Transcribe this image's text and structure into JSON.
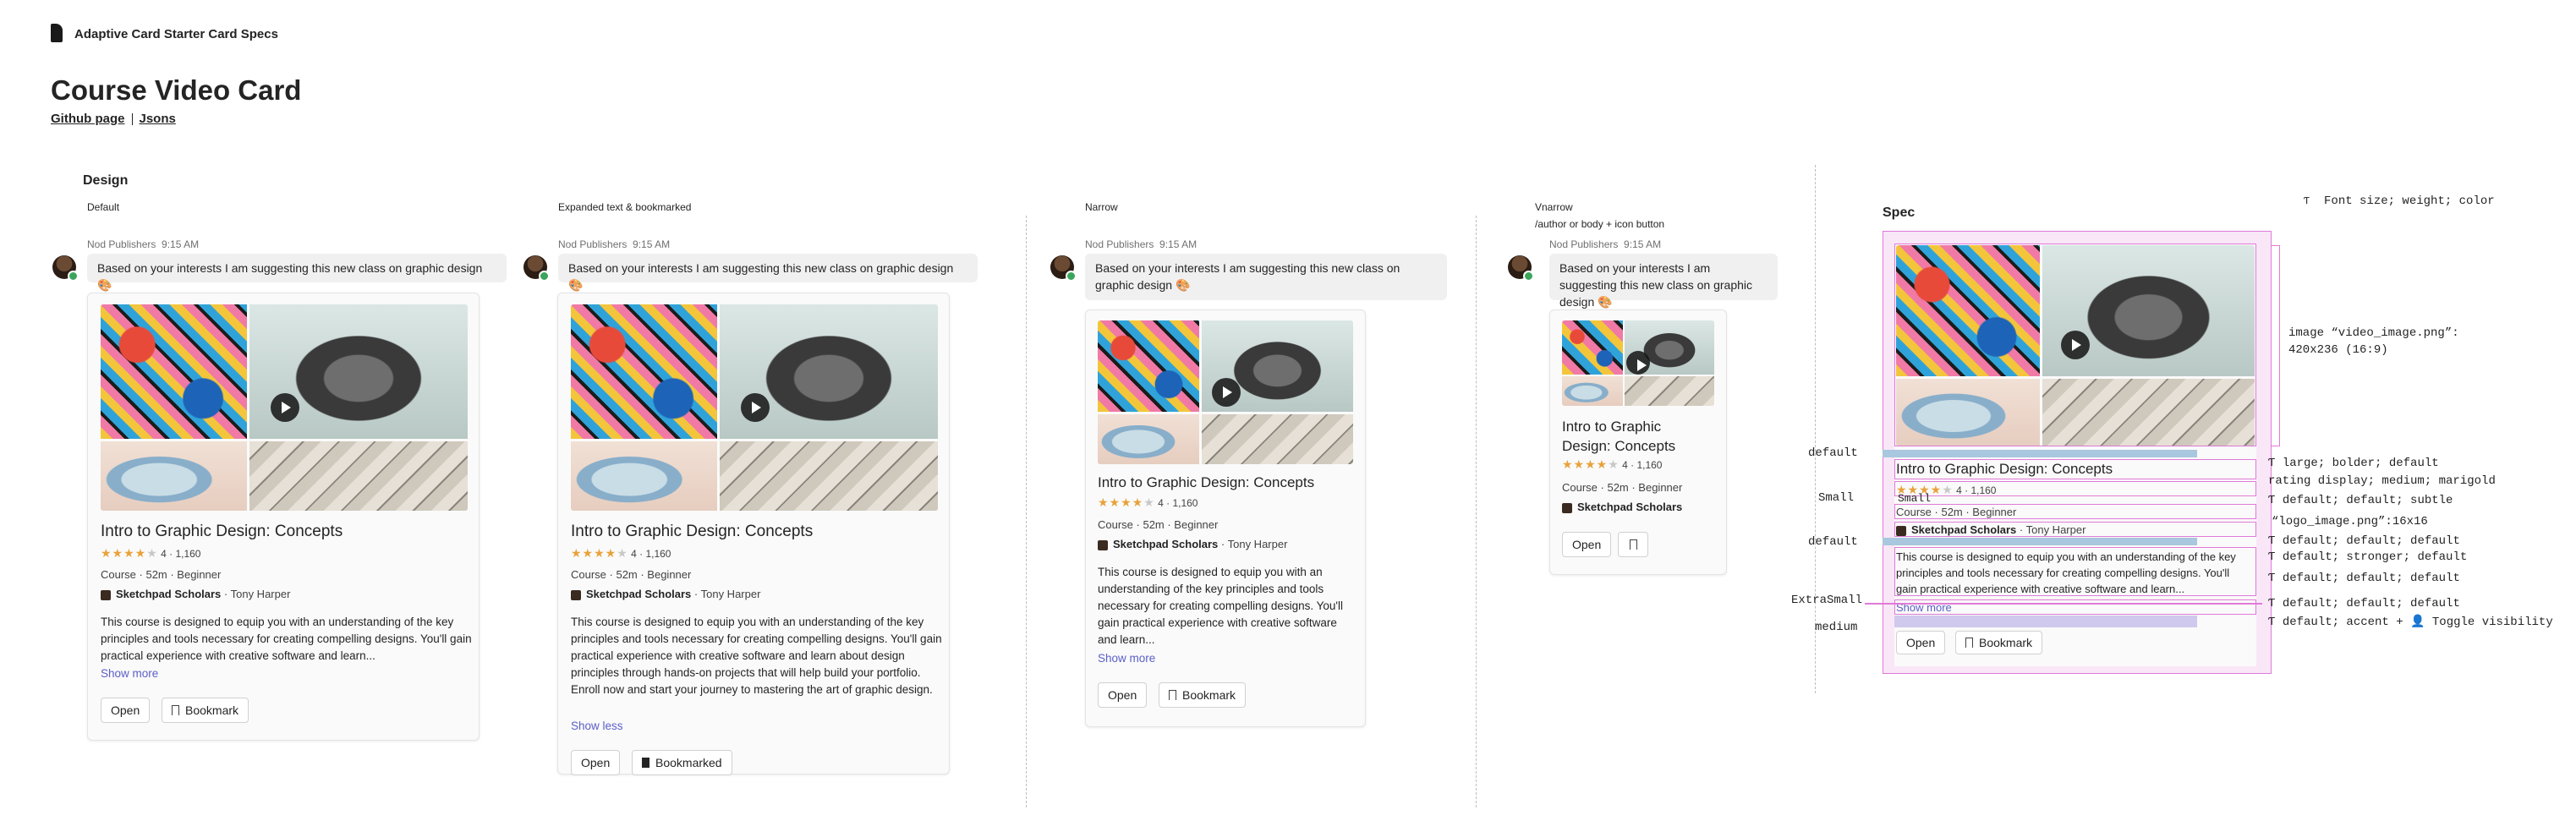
{
  "header": {
    "brand": "Adaptive Card Starter Card Specs",
    "title": "Course Video Card",
    "link_github": "Github page",
    "link_jsons": "Jsons"
  },
  "design_heading": "Design",
  "spec_heading": "Spec",
  "variants": [
    {
      "label": "Default",
      "label2": "",
      "publisher": "Nod Publishers",
      "time": "9:15 AM",
      "message": "Based on your interests I am suggesting this new class on graphic design 🎨",
      "desc": "This course is designed to equip you with an understanding of the key principles and tools necessary for creating compelling designs. You'll gain practical experience with creative software and learn...",
      "toggle": "Show more",
      "open": "Open",
      "bookmark": "Bookmark"
    },
    {
      "label": "Expanded text & bookmarked",
      "label2": "",
      "publisher": "Nod Publishers",
      "time": "9:15 AM",
      "message": "Based on your interests I am suggesting this new class on graphic design 🎨",
      "desc": "This course is designed to equip you with an understanding of the key principles and tools necessary for creating compelling designs. You'll gain practical experience with creative software and learn about design principles through hands-on projects that will help build your portfolio. Enroll now and start your journey to mastering the art of graphic design.",
      "toggle": "Show less",
      "open": "Open",
      "bookmark": "Bookmarked"
    },
    {
      "label": "Narrow",
      "label2": "",
      "publisher": "Nod Publishers",
      "time": "9:15 AM",
      "message": "Based on your interests I am suggesting this new class on graphic design 🎨",
      "desc": "This course is designed to equip you with an understanding of the key principles and tools necessary for creating compelling designs. You'll gain practical experience with creative software and learn...",
      "toggle": "Show more",
      "open": "Open",
      "bookmark": "Bookmark"
    },
    {
      "label": "Vnarrow",
      "label2": "/author or body + icon button",
      "publisher": "Nod Publishers",
      "time": "9:15 AM",
      "message": "Based on your interests I am suggesting this new class on graphic design 🎨",
      "desc": "",
      "toggle": "",
      "open": "Open",
      "bookmark": ""
    }
  ],
  "course": {
    "title": "Intro to Graphic Design: Concepts",
    "rating": "4",
    "reviews": "1,160",
    "rating_text": "4 · 1,160",
    "stars_filled": 4,
    "stars_total": 5,
    "meta": "Course · 52m · Beginner",
    "publisher": "Sketchpad Scholars",
    "author": "· Tony Harper",
    "title_short_1": "Intro to Graphic",
    "title_short_2": "Design: Concepts"
  },
  "spec": {
    "legend": "Font size; weight; color",
    "image_note_1": "image “video_image.png”:",
    "image_note_2": "420x236 (16:9)",
    "left_labels": [
      "default",
      "Small",
      "default",
      "ExtraSmall",
      "medium"
    ],
    "small_inline": "Small",
    "right_notes": [
      "large; bolder; default",
      "rating display; medium; marigold",
      "default; default; subtle",
      "“logo_image.png”:16x16",
      "default; default; default",
      "default; stronger; default",
      "default; default; default",
      "default; default; default",
      "default; accent + ",
      "Toggle visibility"
    ],
    "desc": "This course is designed to equip you with an understanding of the key principles and tools necessary for creating compelling designs. You'll gain practical experience with creative software and learn...",
    "toggle": "Show more",
    "open": "Open",
    "bookmark": "Bookmark"
  },
  "colors": {
    "accent": "#5b5fc7",
    "marigold": "#e8a23a",
    "spec_pink": "#e07ad8",
    "spec_blue": "#a9c7de"
  }
}
